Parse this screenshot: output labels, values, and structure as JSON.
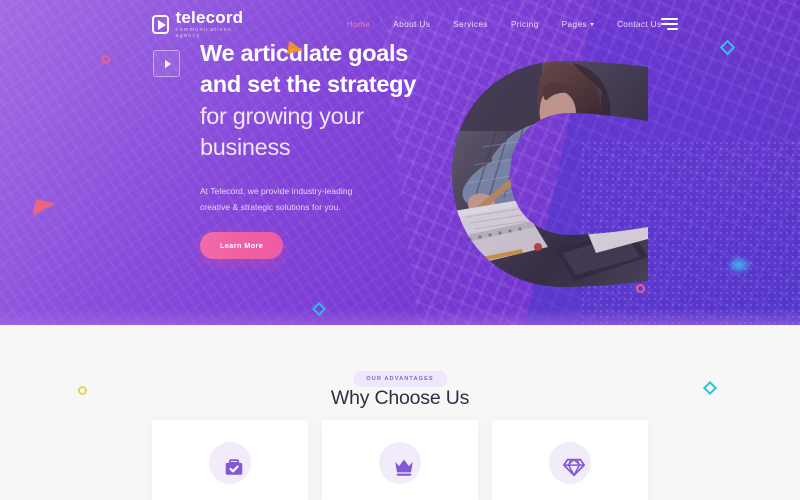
{
  "brand": {
    "name": "telecord",
    "tagline": "communications agency",
    "logo_icon": "play-triangle-logo-icon"
  },
  "nav": {
    "items": [
      {
        "label": "Home",
        "active": true,
        "has_caret": false
      },
      {
        "label": "About Us",
        "active": false,
        "has_caret": false
      },
      {
        "label": "Services",
        "active": false,
        "has_caret": false
      },
      {
        "label": "Pricing",
        "active": false,
        "has_caret": false
      },
      {
        "label": "Pages",
        "active": false,
        "has_caret": true
      },
      {
        "label": "Contact Us",
        "active": false,
        "has_caret": false
      }
    ],
    "menu_icon": "hamburger-menu-icon"
  },
  "hero": {
    "play_icon": "play-button-icon",
    "title_line1": "We articulate goals",
    "title_line2": "and set the strategy",
    "title_line3": "for growing your",
    "title_line4": "business",
    "subtitle_line1": "At Telecord, we provide industry-leading",
    "subtitle_line2": "creative & strategic solutions for you.",
    "cta_label": "Learn More",
    "image_mask_letter": "C",
    "image_alt": "woman writing in notebook at desk",
    "colors": {
      "gradient_from": "#9a5fe0",
      "gradient_to": "#5f35c6",
      "cta_pink": "#ef5fa3",
      "nav_active": "#f07ec0"
    },
    "decorations": [
      {
        "name": "pink-circle-outline",
        "color": "#e8608f"
      },
      {
        "name": "orange-triangle",
        "color": "#f2922e"
      },
      {
        "name": "cyan-diamond-outline",
        "color": "#2fc3e8"
      },
      {
        "name": "pink-triangle",
        "color": "#f0647f"
      },
      {
        "name": "cyan-glow-dot",
        "color": "#3cc8f5"
      },
      {
        "name": "blue-diamond-outline",
        "color": "#2fb7e8"
      },
      {
        "name": "pink-circle-outline-2",
        "color": "#e8608f"
      }
    ]
  },
  "advantages": {
    "badge": "OUR ADVANTAGES",
    "title": "Why Choose Us",
    "background": "#f7f7f8",
    "accent": "#8b63c9",
    "cards": [
      {
        "icon": "briefcase-check-icon"
      },
      {
        "icon": "crown-icon"
      },
      {
        "icon": "diamond-gem-icon"
      }
    ],
    "decorations": [
      {
        "name": "yellow-circle-outline",
        "color": "#e8d24e"
      },
      {
        "name": "teal-diamond-outline",
        "color": "#2fc3d8"
      }
    ]
  }
}
